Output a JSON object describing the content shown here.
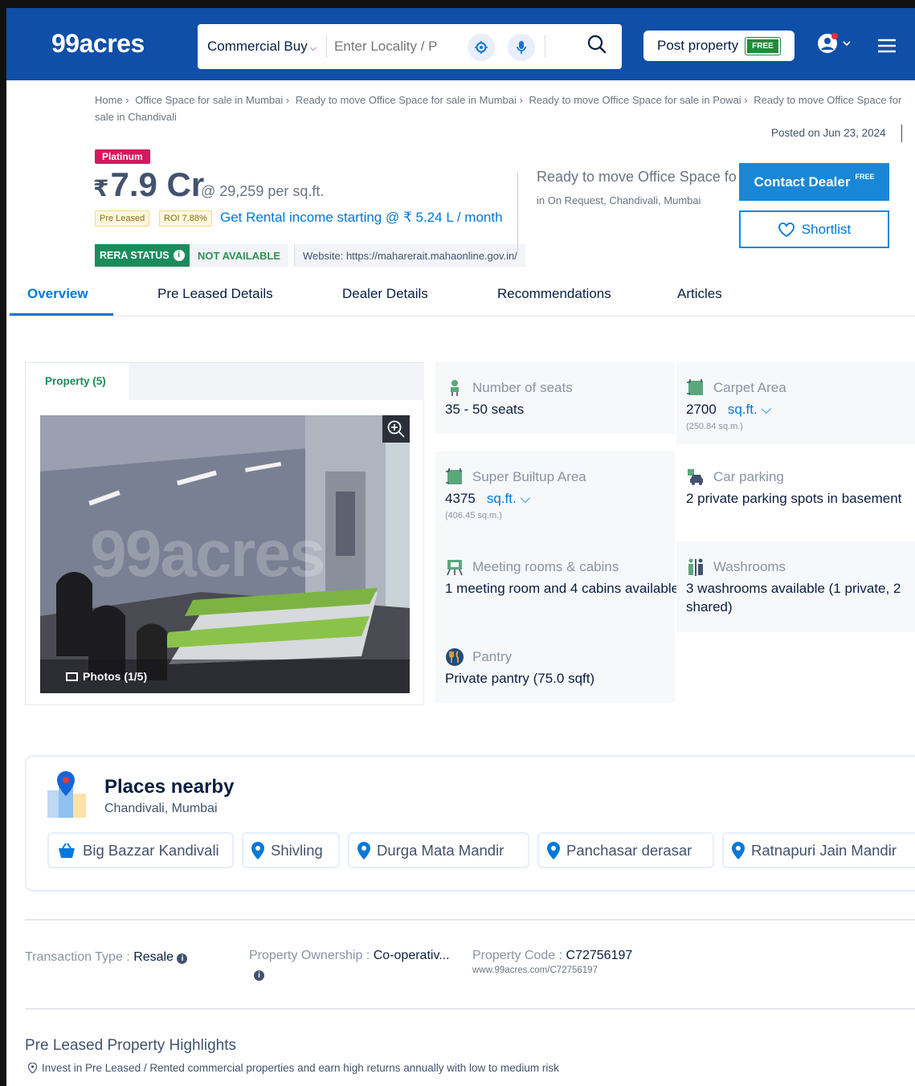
{
  "header": {
    "logo": "99acres",
    "search_category": "Commercial Buy",
    "search_placeholder": "Enter Locality / P",
    "post_property_label": "Post property",
    "post_property_badge": "FREE"
  },
  "breadcrumb": {
    "items": [
      "Home ›",
      "Office Space for sale in Mumbai ›",
      "Ready to move Office Space for sale in Mumbai ›",
      "Ready to move Office Space for sale in Powai ›",
      "Ready to move Office Space for sale in Chandivali"
    ]
  },
  "posted": "Posted on Jun 23, 2024",
  "listing": {
    "badge": "Platinum",
    "price_symbol": "₹",
    "price": "7.9 Cr",
    "price_per_sqft": "@ 29,259 per sq.ft.",
    "tag_pre_leased": "Pre Leased",
    "tag_roi": "ROI 7.88%",
    "rental_link": "Get Rental income starting @ ₹ 5.24 L / month",
    "rera_label": "RERA STATUS",
    "rera_value": "NOT AVAILABLE",
    "rera_website": "Website: https://maharerait.mahaonline.gov.in/",
    "title": "Ready to move Office Space for sale",
    "location": "in On Request, Chandivali, Mumbai",
    "contact_label": "Contact Dealer",
    "contact_badge": "FREE",
    "shortlist_label": "Shortlist"
  },
  "tabs": [
    "Overview",
    "Pre Leased Details",
    "Dealer Details",
    "Recommendations",
    "Articles"
  ],
  "gallery": {
    "tab_label": "Property (5)",
    "watermark": "99acres",
    "photo_caption": "Photos (1/5)"
  },
  "details": {
    "seats_label": "Number of seats",
    "seats_value": "35 - 50 seats",
    "carpet_label": "Carpet Area",
    "carpet_value": "2700",
    "carpet_unit": "sq.ft.",
    "carpet_sub": "(250.84 sq.m.)",
    "super_label": "Super Builtup Area",
    "super_value": "4375",
    "super_unit": "sq.ft.",
    "super_sub": "(406.45 sq.m.)",
    "parking_label": "Car parking",
    "parking_value": "2 private parking spots in basement",
    "meeting_label": "Meeting rooms & cabins",
    "meeting_value": "1 meeting room and 4 cabins available",
    "washroom_label": "Washrooms",
    "washroom_value": "3 washrooms available (1 private, 2 shared)",
    "pantry_label": "Pantry",
    "pantry_value": "Private pantry (75.0 sqft)"
  },
  "places": {
    "title": "Places nearby",
    "subtitle": "Chandivali, Mumbai",
    "chips": [
      "Big Bazzar Kandivali",
      "Shivling",
      "Durga Mata Mandir",
      "Panchasar derasar",
      "Ratnapuri Jain Mandir"
    ]
  },
  "transaction": {
    "type_label": "Transaction Type",
    "type_value": "Resale",
    "ownership_label": "Property Ownership",
    "ownership_value": "Co-operativ...",
    "code_label": "Property Code",
    "code_value": "C72756197",
    "code_url": "www.99acres.com/C72756197"
  },
  "highlights": {
    "title": "Pre Leased Property Highlights",
    "item": "Invest in Pre Leased / Rented commercial properties and earn high returns annually with low to medium risk"
  },
  "colors": {
    "brand_blue": "#0f4fa8",
    "link_blue": "#0078db",
    "platinum": "#d6185d",
    "rera_green": "#1a8c5c"
  }
}
